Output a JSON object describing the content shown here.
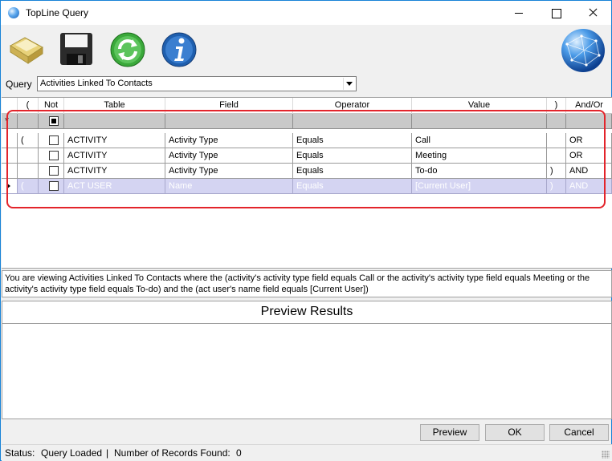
{
  "window": {
    "title": "TopLine Query"
  },
  "toolbar": {
    "icons": [
      "open-folder-icon",
      "save-disk-icon",
      "refresh-icon",
      "info-icon",
      "globe-icon"
    ]
  },
  "query": {
    "label": "Query",
    "selected": "Activities Linked To Contacts"
  },
  "grid": {
    "headers": [
      "(",
      "Not",
      "Table",
      "Field",
      "Operator",
      "Value",
      ")",
      "And/Or"
    ],
    "new_row_marker": "*",
    "rows": [
      {
        "open": "(",
        "not": false,
        "table": "ACTIVITY",
        "field": "Activity Type",
        "operator": "Equals",
        "value": "Call",
        "close": "",
        "andor": "OR"
      },
      {
        "open": "",
        "not": false,
        "table": "ACTIVITY",
        "field": "Activity Type",
        "operator": "Equals",
        "value": "Meeting",
        "close": "",
        "andor": "OR"
      },
      {
        "open": "",
        "not": false,
        "table": "ACTIVITY",
        "field": "Activity Type",
        "operator": "Equals",
        "value": "To-do",
        "close": ")",
        "andor": "AND"
      },
      {
        "open": "(",
        "not": false,
        "table": "ACT USER",
        "field": "Name",
        "operator": "Equals",
        "value": "[Current User]",
        "close": ")",
        "andor": "AND"
      }
    ]
  },
  "description": "You are viewing Activities Linked To Contacts where the (activity's activity type field equals Call or the activity's activity type field equals Meeting or the activity's activity type field equals To-do) and the (act user's name field equals [Current User])",
  "preview": {
    "title": "Preview Results"
  },
  "buttons": {
    "preview": "Preview",
    "ok": "OK",
    "cancel": "Cancel"
  },
  "status": {
    "label": "Status:",
    "value": "Query Loaded",
    "separator": "|",
    "records_label": "Number of Records Found:",
    "records_count": "0"
  },
  "colors": {
    "highlight": "#e3242b",
    "selected_row": "#d4d4f2",
    "new_row": "#c9c9c9"
  }
}
